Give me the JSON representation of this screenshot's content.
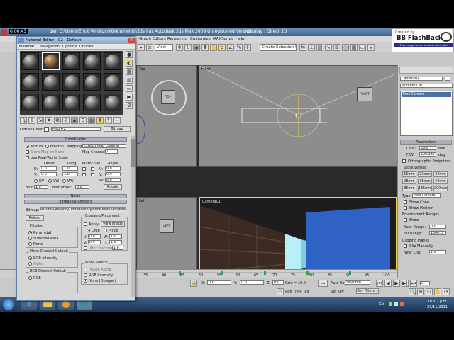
{
  "app": {
    "window_title": "Autodesk 3ds Max  2009    Unregistered Version",
    "title_path": "der: C:\\Users\\Erick Verduzco\\Documents\\3dsmax",
    "display_mode": "Display : Direct 3D",
    "recording": "0:00:43"
  },
  "menubar": {
    "items": [
      "Graph Editors",
      "Rendering",
      "Customize",
      "MAXScript",
      "Help"
    ]
  },
  "toolbar": {
    "view_select": "View",
    "selection_set": "Create Selection Set"
  },
  "watermark": {
    "line1": "Created by",
    "line2": "BB FlashBack",
    "line3": "This image removed when licensed"
  },
  "material_editor": {
    "title": "Material Editor - 02 - Default",
    "menu": [
      "Material",
      "Navigation",
      "Options",
      "Utilities"
    ],
    "diffuse_label": "Diffuse Color:",
    "map_name": "Map #2",
    "map_type": "Bitmap",
    "coordinates": {
      "header": "Coordinates",
      "texture": "Texture",
      "environ": "Environ",
      "mapping_label": "Mapping:",
      "mapping_value": "Explicit Map Channel",
      "show_map_on_back": "Show Map on Back",
      "map_channel_label": "Map Channel:",
      "map_channel_value": "1",
      "real_world": "Use Real-World Scale",
      "col_offset": "Offset",
      "col_tiling": "Tiling",
      "col_mirror_tile": "Mirror Tile",
      "col_angle": "Angle",
      "u_label": "U:",
      "v_label": "V:",
      "w_label": "W:",
      "u_offset": "0.0",
      "v_offset": "0.0",
      "u_tiling": "1.0",
      "v_tiling": "1.0",
      "u_angle": "0.0",
      "v_angle": "0.0",
      "w_angle": "0.0",
      "uv": "UV",
      "vw": "VW",
      "wu": "WU",
      "blur_label": "Blur:",
      "blur_value": "1.0",
      "blur_offset_label": "Blur offset:",
      "blur_offset_value": "0.0",
      "rotate": "Rotate"
    },
    "noise_header": "Noise",
    "bitmap_params": {
      "header": "Bitmap Parameters",
      "bitmap_label": "Bitmap:",
      "bitmap_path": "extures\\Masonry.Unit.Masonry.Brick.Modular.Dbksk.jpg",
      "reload": "Reload",
      "cropping_label": "Cropping/Placement",
      "apply": "Apply",
      "view_image": "View Image",
      "crop": "Crop",
      "place": "Place",
      "u": "U:",
      "w": "W:",
      "v": "V:",
      "h": "H:",
      "u_val": "0.0",
      "w_val": "1.0",
      "v_val": "0.0",
      "h_val": "1.0",
      "jitter": "Jitter Placement",
      "jitter_val": "1.0",
      "filtering_label": "Filtering",
      "pyramidal": "Pyramidal",
      "summed": "Summed Area",
      "none": "None",
      "mono_label": "Mono Channel Output:",
      "rgb_intensity": "RGB Intensity",
      "alpha": "Alpha",
      "rgb_out_label": "RGB Channel Output:",
      "rgb": "RGB",
      "alpha_source_label": "Alpha Source",
      "image_alpha": "Image Alpha",
      "rgb_intensity2": "RGB Intensity",
      "none_opaque": "None (Opaque)"
    }
  },
  "viewports": {
    "top": "Top",
    "front": "Front",
    "left": "Left",
    "camera": "Camera01",
    "box_top": "TOP",
    "box_front": "FRONT",
    "box_left": "LEFT"
  },
  "command_panel": {
    "object_name": "Camera01",
    "modifier_list": "Modifier List",
    "stack_item": "Free Camera",
    "parameters": "Parameters",
    "lens_label": "Lens:",
    "lens_value": "35.0",
    "lens_unit": "mm",
    "fov_label": "FOV:",
    "fov_value": "100.389",
    "fov_unit": "deg",
    "ortho": "Orthographic Projection",
    "stock_lenses": "Stock Lenses",
    "lenses": [
      "15mm",
      "20mm",
      "24mm",
      "28mm",
      "35mm",
      "50mm",
      "85mm",
      "135mm",
      "200mm"
    ],
    "type_label": "Type:",
    "type_value": "Free Camera",
    "show_cone": "Show Cone",
    "show_horizon": "Show Horizon",
    "env_ranges": "Environment Ranges",
    "show": "Show",
    "near_range_label": "Near Range:",
    "near_range_value": "0.0",
    "far_range_label": "Far Range:",
    "far_range_value": "1000.0",
    "clipping_planes": "Clipping Planes",
    "clip_manually": "Clip Manually",
    "near_clip_label": "Near Clip:",
    "near_clip_value": "1.0"
  },
  "timeline": {
    "ticks": [
      "35",
      "40",
      "45",
      "50",
      "55",
      "60",
      "65",
      "70",
      "75",
      "80",
      "85",
      "90",
      "95",
      "100"
    ],
    "x_label": "X:",
    "x_value": "0.0",
    "y_label": "Y:",
    "y_value": "0.0",
    "z_label": "Z:",
    "z_value": "0.0",
    "grid": "Grid = 10.0",
    "add_time_tag": "Add Time Tag",
    "auto_key": "Auto Key",
    "selected": "Selected",
    "set_key": "Set Key",
    "key_filters": "Key Filters...",
    "frame": "0"
  },
  "taskbar": {
    "lang": "ES",
    "time": "01:07 p.m.",
    "date": "23/11/2011"
  },
  "colors": {
    "viewport_bg": "#8d8d8d",
    "active_border": "#f2d54a",
    "blue_box": "#2f62c4",
    "taskbar": "#1c3656"
  }
}
